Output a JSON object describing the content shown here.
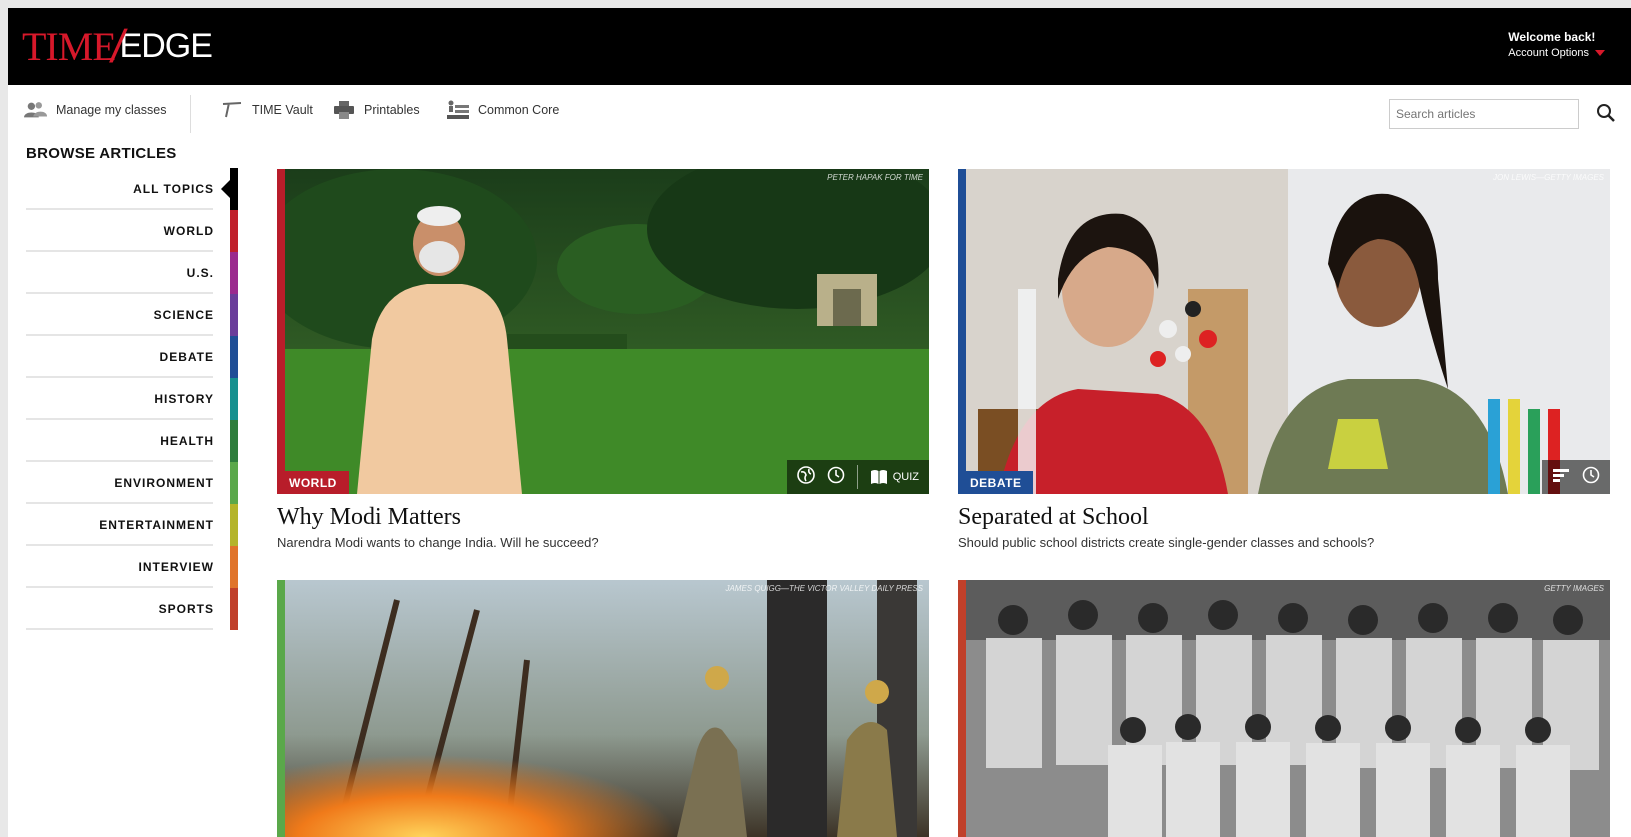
{
  "header": {
    "logo_time": "TIME",
    "logo_edge": "EDGE",
    "welcome": "Welcome back!",
    "account_options": "Account Options"
  },
  "toolbar": {
    "manage_classes": "Manage my classes",
    "time_vault": "TIME Vault",
    "printables": "Printables",
    "common_core": "Common Core",
    "search_placeholder": "Search articles"
  },
  "sidebar": {
    "title": "BROWSE ARTICLES",
    "topics": [
      {
        "label": "ALL TOPICS",
        "color": "#000000"
      },
      {
        "label": "WORLD",
        "color": "#c0202b"
      },
      {
        "label": "U.S.",
        "color": "#9b2a8e"
      },
      {
        "label": "SCIENCE",
        "color": "#6a3d9a"
      },
      {
        "label": "DEBATE",
        "color": "#1f4e96"
      },
      {
        "label": "HISTORY",
        "color": "#16908f"
      },
      {
        "label": "HEALTH",
        "color": "#2e7d3c"
      },
      {
        "label": "ENVIRONMENT",
        "color": "#5aa84a"
      },
      {
        "label": "ENTERTAINMENT",
        "color": "#b4b42a"
      },
      {
        "label": "INTERVIEW",
        "color": "#e0742a"
      },
      {
        "label": "SPORTS",
        "color": "#c0402a"
      }
    ]
  },
  "articles": [
    {
      "tag": "WORLD",
      "color": "#b81d2a",
      "credit": "PETER HAPAK FOR TIME",
      "title": "Why Modi Matters",
      "subtitle": "Narendra Modi wants to change India. Will he succeed?",
      "quiz": "QUIZ"
    },
    {
      "tag": "DEBATE",
      "color": "#1f4e96",
      "credit": "JON LEWIS—GETTY IMAGES",
      "title": "Separated at School",
      "subtitle": "Should public school districts create single-gender classes and schools?"
    },
    {
      "tag": "",
      "color": "#5aa84a",
      "credit": "JAMES QUIGG—THE VICTOR VALLEY DAILY PRESS"
    },
    {
      "tag": "",
      "color": "#c0402a",
      "credit": "GETTY IMAGES"
    }
  ]
}
